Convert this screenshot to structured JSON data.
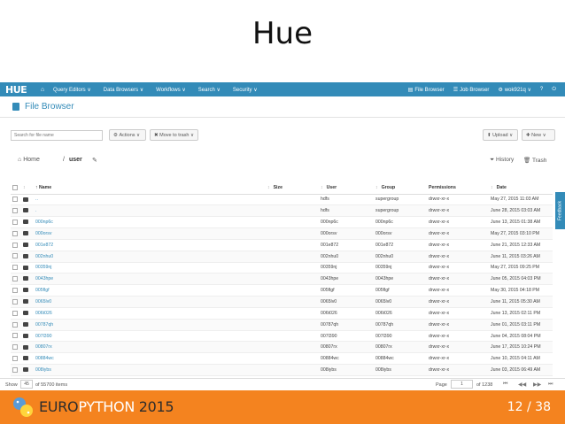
{
  "slide": {
    "title": "Hue",
    "page_number": "12 / 38",
    "footer_logo_a": "EURO",
    "footer_logo_b": "PYTHON",
    "footer_logo_c": " 2015"
  },
  "navbar": {
    "logo": "HUE",
    "items": [
      "Query Editors ∨",
      "Data Browsers ∨",
      "Workflows ∨",
      "Search ∨",
      "Security ∨"
    ],
    "right": {
      "file_browser": "File Browser",
      "job_browser": "Job Browser",
      "user": "wok921q ∨"
    }
  },
  "header": {
    "title": "File Browser"
  },
  "toolbar": {
    "search_placeholder": "Search for file name",
    "actions": "Actions ∨",
    "move_to_trash": "✖ Move to trash ∨",
    "upload": "Upload ∨",
    "new": "New ∨"
  },
  "breadcrumb": {
    "home": "Home",
    "sep": "/",
    "user": "user",
    "history": "History",
    "trash": "Trash"
  },
  "table": {
    "headers": {
      "name": "Name",
      "size": "Size",
      "user": "User",
      "group": "Group",
      "permissions": "Permissions",
      "date": "Date"
    },
    "rows": [
      {
        "name": "..",
        "size": "",
        "user": "hdfs",
        "group": "supergroup",
        "perm": "drwxr-xr-x",
        "date": "May 27, 2015 11:03 AM"
      },
      {
        "name": ".",
        "size": "",
        "user": "hdfs",
        "group": "supergroup",
        "perm": "drwxr-xr-x",
        "date": "June 28, 2015 03:03 AM"
      },
      {
        "name": "000np6c",
        "size": "",
        "user": "000np6c",
        "group": "000np6c",
        "perm": "drwxr-xr-x",
        "date": "June 13, 2015 01:38 AM"
      },
      {
        "name": "000orsv",
        "size": "",
        "user": "000orsv",
        "group": "000orsv",
        "perm": "drwxr-xr-x",
        "date": "May 27, 2015 03:10 PM"
      },
      {
        "name": "001e872",
        "size": "",
        "user": "001e872",
        "group": "001e872",
        "perm": "drwxr-xr-x",
        "date": "June 21, 2015 12:33 AM"
      },
      {
        "name": "002nhu0",
        "size": "",
        "user": "002nhu0",
        "group": "002nhu0",
        "perm": "drwxr-xr-x",
        "date": "June 11, 2015 03:26 AM"
      },
      {
        "name": "00359nj",
        "size": "",
        "user": "00359nj",
        "group": "00359nj",
        "perm": "drwxr-xr-x",
        "date": "May 27, 2015 09:25 PM"
      },
      {
        "name": "0043hpe",
        "size": "",
        "user": "0043hpe",
        "group": "0043hpe",
        "perm": "drwxr-xr-x",
        "date": "June 05, 2015 04:03 PM"
      },
      {
        "name": "005flgf",
        "size": "",
        "user": "005flgf",
        "group": "005flgf",
        "perm": "drwxr-xr-x",
        "date": "May 30, 2015 04:18 PM"
      },
      {
        "name": "0065lv0",
        "size": "",
        "user": "0065lv0",
        "group": "0065lv0",
        "perm": "drwxr-xr-x",
        "date": "June 11, 2015 05:30 AM"
      },
      {
        "name": "006t026",
        "size": "",
        "user": "006t026",
        "group": "006t026",
        "perm": "drwxr-xr-x",
        "date": "June 13, 2015 02:11 PM"
      },
      {
        "name": "00787qh",
        "size": "",
        "user": "00787qh",
        "group": "00787qh",
        "perm": "drwxr-xr-x",
        "date": "June 01, 2015 03:11 PM"
      },
      {
        "name": "007l390",
        "size": "",
        "user": "007l390",
        "group": "007l390",
        "perm": "drwxr-xr-x",
        "date": "June 04, 2015 08:04 PM"
      },
      {
        "name": "00807rx",
        "size": "",
        "user": "00807rx",
        "group": "00807rx",
        "perm": "drwxr-xr-x",
        "date": "June 17, 2015 10:24 PM"
      },
      {
        "name": "00884wc",
        "size": "",
        "user": "00884wc",
        "group": "00884wc",
        "perm": "drwxr-xr-x",
        "date": "June 10, 2015 04:11 AM"
      },
      {
        "name": "008iybs",
        "size": "",
        "user": "008iybs",
        "group": "008iybs",
        "perm": "drwxr-xr-x",
        "date": "June 03, 2015 06:49 AM"
      }
    ]
  },
  "feedback": "Feedback",
  "pager": {
    "show": "Show",
    "per_page": "45",
    "of_items": "of 55700 items",
    "page_label": "Page",
    "page_value": "1",
    "of_pages": "of 1238"
  },
  "colors": {
    "hue_blue": "#338bb8",
    "europython_orange": "#f4831f"
  }
}
